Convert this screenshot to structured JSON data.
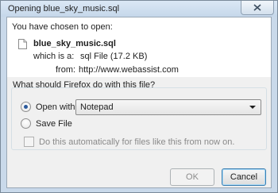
{
  "window": {
    "title": "Opening blue_sky_music.sql",
    "close_icon": "close-icon"
  },
  "info": {
    "intro": "You have chosen to open:",
    "file_name": "blue_sky_music.sql",
    "type_label": "which is a:",
    "type_value": "sql File (17.2 KB)",
    "from_label": "from:",
    "from_value": "http://www.webassist.com"
  },
  "action": {
    "question": "What should Firefox do with this file?",
    "open_with_label": "Open with",
    "open_with_selected": true,
    "app_selected": "Notepad",
    "save_file_label": "Save File",
    "save_file_selected": false,
    "auto_label": "Do this automatically for files like this from now on.",
    "auto_checked": false
  },
  "buttons": {
    "ok": "OK",
    "cancel": "Cancel"
  },
  "colors": {
    "frame": "#c9d9ea",
    "accent": "#2b5a9c",
    "close_button": "#d3e0ed"
  }
}
